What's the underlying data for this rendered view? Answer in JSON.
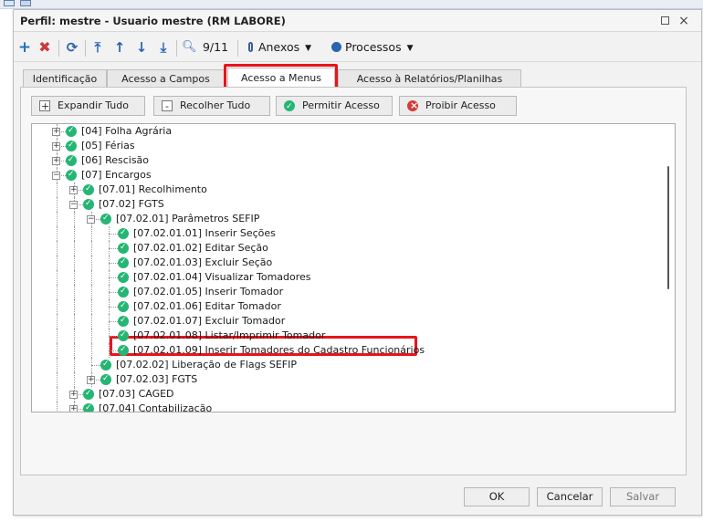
{
  "window": {
    "title": "Perfil: mestre - Usuario mestre (RM LABORE)",
    "close_glyph": "×"
  },
  "toolbar": {
    "record_position": "9/11",
    "anexos_label": "Anexos",
    "processos_label": "Processos",
    "icons": [
      "plus-icon",
      "delete-x-icon",
      "refresh-icon",
      "first-icon",
      "previous-icon",
      "next-icon",
      "last-icon",
      "search-icon",
      "paperclip-icon",
      "gear-icon"
    ]
  },
  "tabs": [
    {
      "label": "Identificação"
    },
    {
      "label": "Acesso a Campos"
    },
    {
      "label": "Acesso a Menus",
      "active": true
    },
    {
      "label": "Acesso à Relatórios/Planilhas"
    }
  ],
  "actions": {
    "expand_all": "Expandir Tudo",
    "collapse_all": "Recolher Tudo",
    "allow_access": "Permitir Acesso",
    "deny_access": "Proibir Acesso"
  },
  "tree": [
    {
      "label": "[04] Folha Agrária",
      "level": 2,
      "expander": "+"
    },
    {
      "label": "[05] Férias",
      "level": 2,
      "expander": "+"
    },
    {
      "label": "[06] Rescisão",
      "level": 2,
      "expander": "+"
    },
    {
      "label": "[07] Encargos",
      "level": 2,
      "expander": "-"
    },
    {
      "label": "[07.01] Recolhimento",
      "level": 3,
      "expander": "+"
    },
    {
      "label": "[07.02] FGTS",
      "level": 3,
      "expander": "-"
    },
    {
      "label": "[07.02.01] Parâmetros SEFIP",
      "level": 4,
      "expander": "-"
    },
    {
      "label": "[07.02.01.01] Inserir Seções",
      "level": 5,
      "expander": ""
    },
    {
      "label": "[07.02.01.02] Editar Seção",
      "level": 5,
      "expander": ""
    },
    {
      "label": "[07.02.01.03] Excluir Seção",
      "level": 5,
      "expander": ""
    },
    {
      "label": "[07.02.01.04] Visualizar Tomadores",
      "level": 5,
      "expander": ""
    },
    {
      "label": "[07.02.01.05] Inserir Tomador",
      "level": 5,
      "expander": ""
    },
    {
      "label": "[07.02.01.06] Editar Tomador",
      "level": 5,
      "expander": ""
    },
    {
      "label": "[07.02.01.07] Excluir Tomador",
      "level": 5,
      "expander": ""
    },
    {
      "label": "[07.02.01.08] Listar/Imprimir Tomador",
      "level": 5,
      "expander": ""
    },
    {
      "label": "[07.02.01.09] Inserir Tomadores do Cadastro Funcionários",
      "level": 5,
      "expander": "",
      "highlighted": true
    },
    {
      "label": "[07.02.02] Liberação de Flags SEFIP",
      "level": 4,
      "expander": ""
    },
    {
      "label": "[07.02.03] FGTS",
      "level": 4,
      "expander": "+"
    },
    {
      "label": "[07.03] CAGED",
      "level": 3,
      "expander": "+"
    },
    {
      "label": "[07.04] Contabilização",
      "level": 3,
      "expander": "+"
    }
  ],
  "footer": {
    "ok": "OK",
    "cancel": "Cancelar",
    "save": "Salvar"
  },
  "colors": {
    "check_green": "#25b574",
    "highlight_red": "#e8141b",
    "toolbar_blue": "#2a64b0"
  }
}
